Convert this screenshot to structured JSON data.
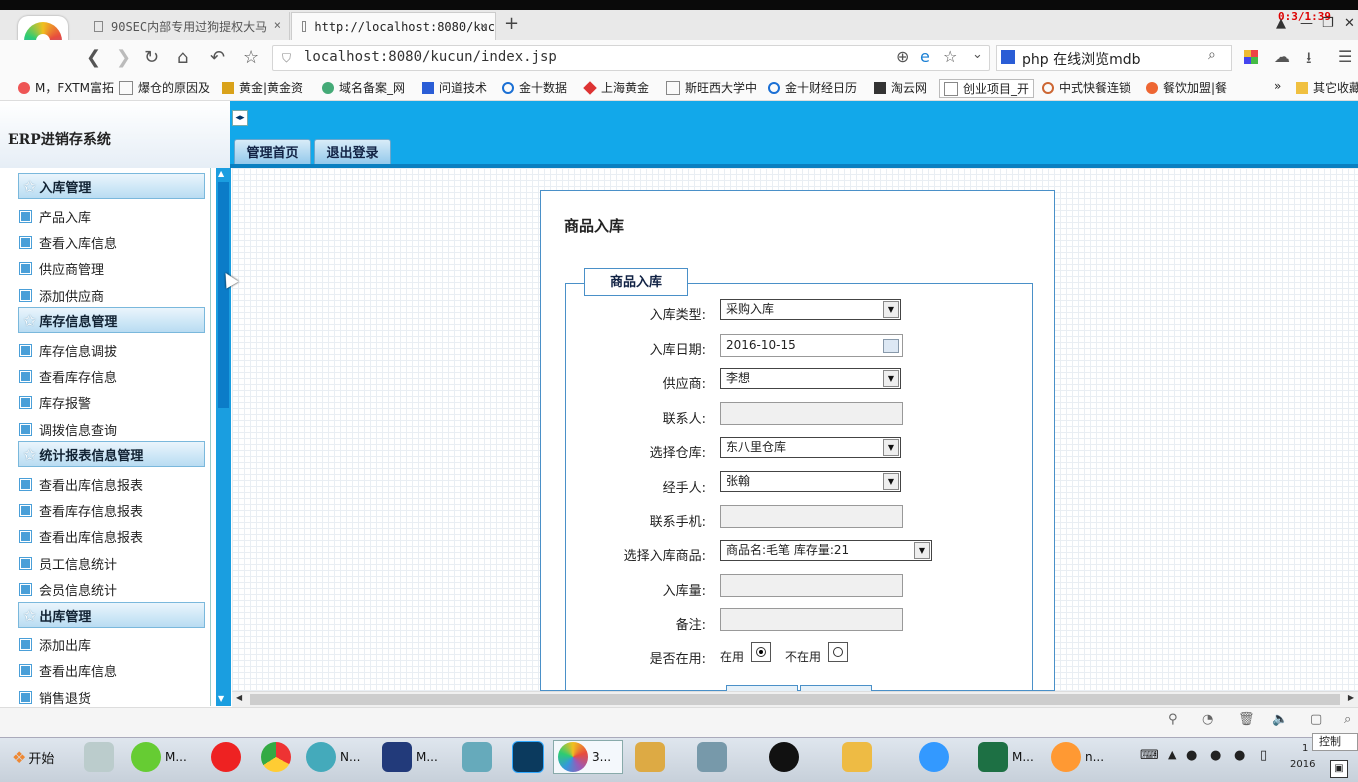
{
  "browser": {
    "clock": "0:3/1:39",
    "tabs": [
      {
        "label": "90SEC内部专用过狗提权大马"
      },
      {
        "label": "http://localhost:8080/kuc"
      }
    ],
    "url": "localhost:8080/kucun/index.jsp",
    "search_value": "php 在线浏览mdb",
    "bookmarks": [
      "M，FXTM富拓",
      "爆仓的原因及",
      "黄金|黄金资",
      "域名备案_网",
      "问道技术",
      "金十数据",
      "上海黄金",
      "斯旺西大学中",
      "金十财经日历",
      "淘云网",
      "创业项目_开",
      "中式快餐连锁",
      "餐饮加盟|餐"
    ],
    "bookmarks_more": "»",
    "other_bookmarks": "其它收藏"
  },
  "app": {
    "title": "ERP进销存系统",
    "nav_tabs": [
      "管理首页",
      "退出登录"
    ],
    "sidebar": {
      "sections": [
        {
          "title": "入库管理",
          "items": [
            "产品入库",
            "查看入库信息",
            "供应商管理",
            "添加供应商"
          ]
        },
        {
          "title": "库存信息管理",
          "items": [
            "库存信息调拔",
            "查看库存信息",
            "库存报警",
            "调拨信息查询"
          ]
        },
        {
          "title": "统计报表信息管理",
          "items": [
            "查看出库信息报表",
            "查看库存信息报表",
            "查看出库信息报表",
            "员工信息统计",
            "会员信息统计"
          ]
        },
        {
          "title": "出库管理",
          "items": [
            "添加出库",
            "查看出库信息",
            "销售退货"
          ]
        }
      ]
    },
    "form": {
      "page_title": "商品入库",
      "legend": "商品入库",
      "fields": {
        "type_label": "入库类型:",
        "type_value": "采购入库",
        "date_label": "入库日期:",
        "date_value": "2016-10-15",
        "supplier_label": "供应商:",
        "supplier_value": "李想",
        "contact_label": "联系人:",
        "contact_value": "",
        "warehouse_label": "选择仓库:",
        "warehouse_value": "东八里仓库",
        "handler_label": "经手人:",
        "handler_value": "张翰",
        "phone_label": "联系手机:",
        "phone_value": "",
        "product_label": "选择入库商品:",
        "product_value": "商品名:毛笔  库存量:21",
        "qty_label": "入库量:",
        "qty_value": "",
        "remark_label": "备注:",
        "remark_value": "",
        "active_label": "是否在用:",
        "active_yes": "在用",
        "active_no": "不在用"
      }
    }
  },
  "taskbar": {
    "start": "开始",
    "items": [
      "M...",
      "N...",
      "M...",
      "3...",
      "M...",
      "n..."
    ],
    "control_label": "控制",
    "clock_partial": "1",
    "date_partial": "2016"
  }
}
